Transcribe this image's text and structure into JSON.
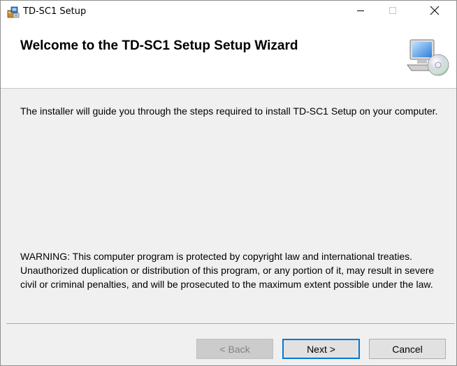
{
  "window": {
    "title": "TD-SC1 Setup"
  },
  "banner": {
    "title": "Welcome to the TD-SC1 Setup Setup Wizard"
  },
  "body": {
    "intro": "The installer will guide you through the steps required to install TD-SC1 Setup on your computer.",
    "warning": "WARNING: This computer program is protected by copyright law and international treaties. Unauthorized duplication or distribution of this program, or any portion of it, may result in severe civil or criminal penalties, and will be prosecuted to the maximum extent possible under the law."
  },
  "buttons": {
    "back": "< Back",
    "next": "Next >",
    "cancel": "Cancel"
  },
  "icons": {
    "app": "installer-package-icon",
    "banner": "computer-cd-icon",
    "minimize": "minimize-icon",
    "maximize": "maximize-icon",
    "close": "close-icon"
  },
  "colors": {
    "accent": "#0078d7",
    "dialog_background": "#f0f0f0",
    "banner_background": "#ffffff"
  }
}
